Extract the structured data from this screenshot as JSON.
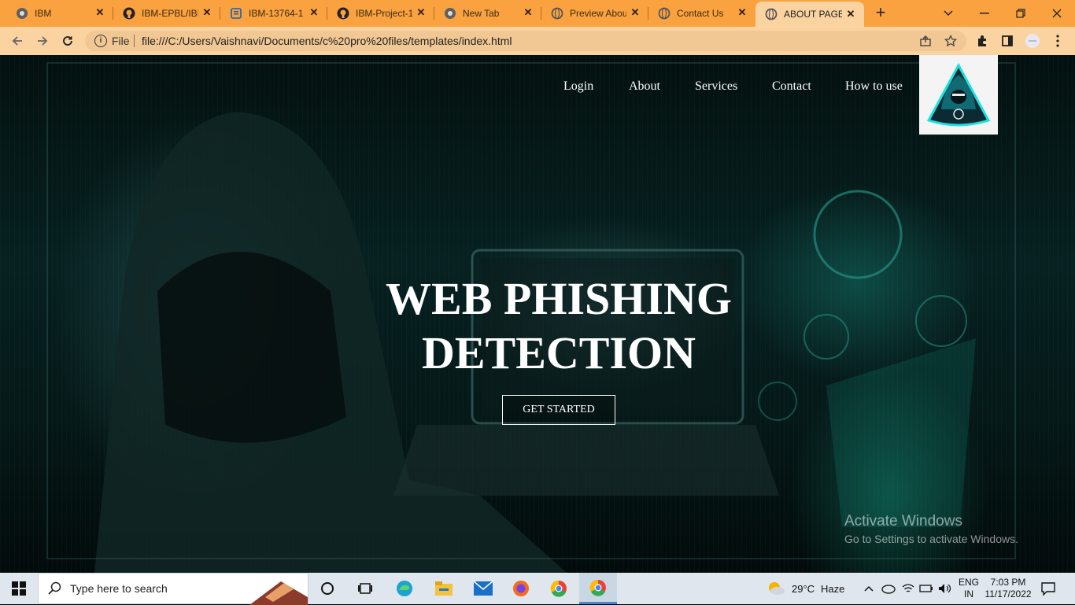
{
  "browser": {
    "tabs": [
      {
        "title": "IBM",
        "icon": "chrome-icon"
      },
      {
        "title": "IBM-EPBL/IBM",
        "icon": "github-icon"
      },
      {
        "title": "IBM-13764-1",
        "icon": "doc-icon"
      },
      {
        "title": "IBM-Project-1",
        "icon": "github-icon"
      },
      {
        "title": "New Tab",
        "icon": "chrome-icon"
      },
      {
        "title": "Preview Abou",
        "icon": "globe-icon"
      },
      {
        "title": "Contact Us",
        "icon": "globe-icon"
      },
      {
        "title": "ABOUT PAGE",
        "icon": "globe-icon",
        "active": true
      }
    ],
    "address": {
      "scheme": "File",
      "url": "file:///C:/Users/Vaishnavi/Documents/c%20pro%20files/templates/index.html"
    },
    "accent_color": "#f9a23f",
    "toolbar_color": "#fbd3a1"
  },
  "page": {
    "nav": {
      "login": "Login",
      "about": "About",
      "services": "Services",
      "contact": "Contact",
      "how_to_use": "How to use"
    },
    "hero": {
      "title_line1": "WEB PHISHING",
      "title_line2": "DETECTION",
      "cta_label": "GET STARTED"
    },
    "watermark": {
      "line1": "Activate Windows",
      "line2": "Go to Settings to activate Windows."
    }
  },
  "taskbar": {
    "search_placeholder": "Type here to search",
    "weather": {
      "temp": "29°C",
      "condition": "Haze"
    },
    "language": {
      "lang": "ENG",
      "region": "IN"
    },
    "clock": {
      "time": "7:03 PM",
      "date": "11/17/2022"
    }
  }
}
